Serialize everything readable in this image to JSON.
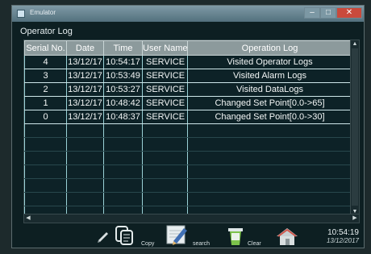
{
  "window": {
    "title": "Emulator"
  },
  "screen": {
    "title": "Operator Log"
  },
  "table": {
    "columns": [
      "Serial No.",
      "Date",
      "Time",
      "User Name",
      "Operation Log"
    ],
    "rows": [
      [
        "4",
        "13/12/17",
        "10:54:17",
        "SERVICE",
        "Visited Operator Logs"
      ],
      [
        "3",
        "13/12/17",
        "10:53:49",
        "SERVICE",
        "Visited Alarm Logs"
      ],
      [
        "2",
        "13/12/17",
        "10:53:27",
        "SERVICE",
        "Visited DataLogs"
      ],
      [
        "1",
        "13/12/17",
        "10:48:42",
        "SERVICE",
        "Changed Set Point[0.0->65]"
      ],
      [
        "0",
        "13/12/17",
        "10:48:37",
        "SERVICE",
        "Changed Set Point[0.0->30]"
      ]
    ],
    "empty_rows": 7
  },
  "toolbar": {
    "copy_label": "Copy",
    "search_label": "search",
    "clear_label": "Clear",
    "icons": [
      "pencil-icon",
      "document-copy-icon",
      "search-icon",
      "trash-icon",
      "home-icon"
    ]
  },
  "clock": {
    "time": "10:54:19",
    "date": "13/12/2017"
  },
  "colors": {
    "background": "#0d1f22",
    "header": "#8c9a9c",
    "row_border": "#9ad1d6",
    "close": "#c94a3c"
  }
}
